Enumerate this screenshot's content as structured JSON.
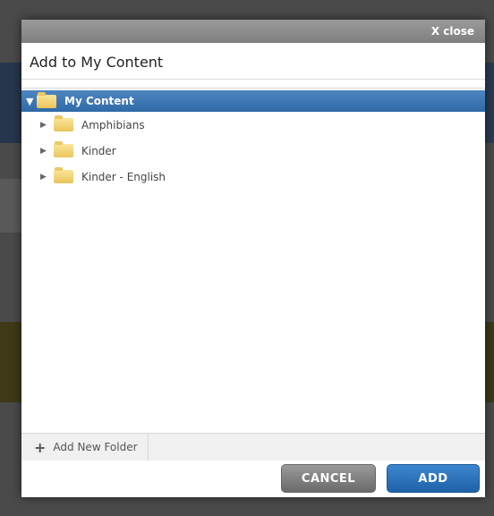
{
  "dialog": {
    "close_label": "X close",
    "title": "Add to My Content"
  },
  "tree": {
    "root_label": "My Content",
    "items": [
      {
        "label": "Amphibians"
      },
      {
        "label": "Kinder"
      },
      {
        "label": "Kinder - English"
      }
    ]
  },
  "footer": {
    "add_folder_label": "Add New Folder",
    "cancel_label": "CANCEL",
    "add_label": "ADD"
  },
  "colors": {
    "accent": "#2f6aa8",
    "titlebar": "#8a8a8a",
    "cancel": "#7a7a7a"
  },
  "icons": {
    "folder": "folder-icon",
    "expand": "triangle-right-icon",
    "collapse": "triangle-down-icon",
    "add": "plus-icon"
  }
}
